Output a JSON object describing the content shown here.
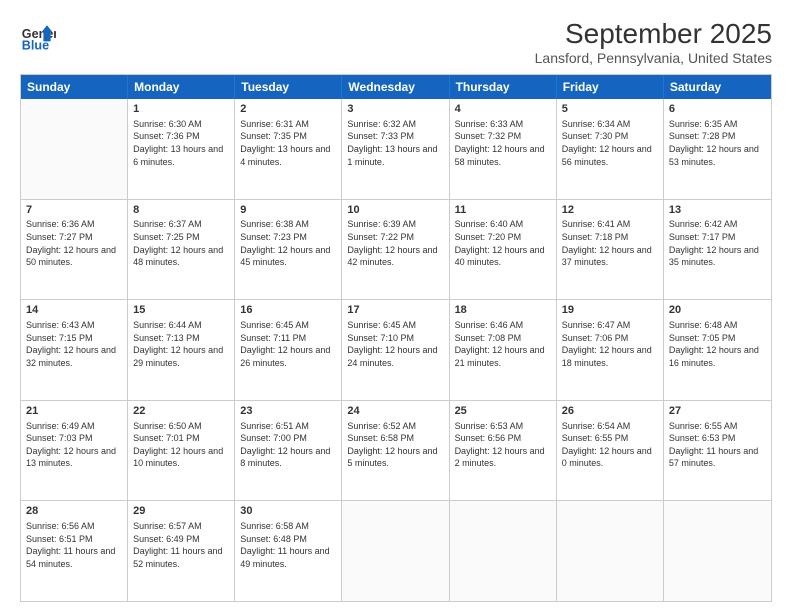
{
  "header": {
    "logo_line1": "General",
    "logo_line2": "Blue",
    "title": "September 2025",
    "subtitle": "Lansford, Pennsylvania, United States"
  },
  "days_of_week": [
    "Sunday",
    "Monday",
    "Tuesday",
    "Wednesday",
    "Thursday",
    "Friday",
    "Saturday"
  ],
  "weeks": [
    [
      {
        "day": "",
        "sunrise": "",
        "sunset": "",
        "daylight": ""
      },
      {
        "day": "1",
        "sunrise": "Sunrise: 6:30 AM",
        "sunset": "Sunset: 7:36 PM",
        "daylight": "Daylight: 13 hours and 6 minutes."
      },
      {
        "day": "2",
        "sunrise": "Sunrise: 6:31 AM",
        "sunset": "Sunset: 7:35 PM",
        "daylight": "Daylight: 13 hours and 4 minutes."
      },
      {
        "day": "3",
        "sunrise": "Sunrise: 6:32 AM",
        "sunset": "Sunset: 7:33 PM",
        "daylight": "Daylight: 13 hours and 1 minute."
      },
      {
        "day": "4",
        "sunrise": "Sunrise: 6:33 AM",
        "sunset": "Sunset: 7:32 PM",
        "daylight": "Daylight: 12 hours and 58 minutes."
      },
      {
        "day": "5",
        "sunrise": "Sunrise: 6:34 AM",
        "sunset": "Sunset: 7:30 PM",
        "daylight": "Daylight: 12 hours and 56 minutes."
      },
      {
        "day": "6",
        "sunrise": "Sunrise: 6:35 AM",
        "sunset": "Sunset: 7:28 PM",
        "daylight": "Daylight: 12 hours and 53 minutes."
      }
    ],
    [
      {
        "day": "7",
        "sunrise": "Sunrise: 6:36 AM",
        "sunset": "Sunset: 7:27 PM",
        "daylight": "Daylight: 12 hours and 50 minutes."
      },
      {
        "day": "8",
        "sunrise": "Sunrise: 6:37 AM",
        "sunset": "Sunset: 7:25 PM",
        "daylight": "Daylight: 12 hours and 48 minutes."
      },
      {
        "day": "9",
        "sunrise": "Sunrise: 6:38 AM",
        "sunset": "Sunset: 7:23 PM",
        "daylight": "Daylight: 12 hours and 45 minutes."
      },
      {
        "day": "10",
        "sunrise": "Sunrise: 6:39 AM",
        "sunset": "Sunset: 7:22 PM",
        "daylight": "Daylight: 12 hours and 42 minutes."
      },
      {
        "day": "11",
        "sunrise": "Sunrise: 6:40 AM",
        "sunset": "Sunset: 7:20 PM",
        "daylight": "Daylight: 12 hours and 40 minutes."
      },
      {
        "day": "12",
        "sunrise": "Sunrise: 6:41 AM",
        "sunset": "Sunset: 7:18 PM",
        "daylight": "Daylight: 12 hours and 37 minutes."
      },
      {
        "day": "13",
        "sunrise": "Sunrise: 6:42 AM",
        "sunset": "Sunset: 7:17 PM",
        "daylight": "Daylight: 12 hours and 35 minutes."
      }
    ],
    [
      {
        "day": "14",
        "sunrise": "Sunrise: 6:43 AM",
        "sunset": "Sunset: 7:15 PM",
        "daylight": "Daylight: 12 hours and 32 minutes."
      },
      {
        "day": "15",
        "sunrise": "Sunrise: 6:44 AM",
        "sunset": "Sunset: 7:13 PM",
        "daylight": "Daylight: 12 hours and 29 minutes."
      },
      {
        "day": "16",
        "sunrise": "Sunrise: 6:45 AM",
        "sunset": "Sunset: 7:11 PM",
        "daylight": "Daylight: 12 hours and 26 minutes."
      },
      {
        "day": "17",
        "sunrise": "Sunrise: 6:45 AM",
        "sunset": "Sunset: 7:10 PM",
        "daylight": "Daylight: 12 hours and 24 minutes."
      },
      {
        "day": "18",
        "sunrise": "Sunrise: 6:46 AM",
        "sunset": "Sunset: 7:08 PM",
        "daylight": "Daylight: 12 hours and 21 minutes."
      },
      {
        "day": "19",
        "sunrise": "Sunrise: 6:47 AM",
        "sunset": "Sunset: 7:06 PM",
        "daylight": "Daylight: 12 hours and 18 minutes."
      },
      {
        "day": "20",
        "sunrise": "Sunrise: 6:48 AM",
        "sunset": "Sunset: 7:05 PM",
        "daylight": "Daylight: 12 hours and 16 minutes."
      }
    ],
    [
      {
        "day": "21",
        "sunrise": "Sunrise: 6:49 AM",
        "sunset": "Sunset: 7:03 PM",
        "daylight": "Daylight: 12 hours and 13 minutes."
      },
      {
        "day": "22",
        "sunrise": "Sunrise: 6:50 AM",
        "sunset": "Sunset: 7:01 PM",
        "daylight": "Daylight: 12 hours and 10 minutes."
      },
      {
        "day": "23",
        "sunrise": "Sunrise: 6:51 AM",
        "sunset": "Sunset: 7:00 PM",
        "daylight": "Daylight: 12 hours and 8 minutes."
      },
      {
        "day": "24",
        "sunrise": "Sunrise: 6:52 AM",
        "sunset": "Sunset: 6:58 PM",
        "daylight": "Daylight: 12 hours and 5 minutes."
      },
      {
        "day": "25",
        "sunrise": "Sunrise: 6:53 AM",
        "sunset": "Sunset: 6:56 PM",
        "daylight": "Daylight: 12 hours and 2 minutes."
      },
      {
        "day": "26",
        "sunrise": "Sunrise: 6:54 AM",
        "sunset": "Sunset: 6:55 PM",
        "daylight": "Daylight: 12 hours and 0 minutes."
      },
      {
        "day": "27",
        "sunrise": "Sunrise: 6:55 AM",
        "sunset": "Sunset: 6:53 PM",
        "daylight": "Daylight: 11 hours and 57 minutes."
      }
    ],
    [
      {
        "day": "28",
        "sunrise": "Sunrise: 6:56 AM",
        "sunset": "Sunset: 6:51 PM",
        "daylight": "Daylight: 11 hours and 54 minutes."
      },
      {
        "day": "29",
        "sunrise": "Sunrise: 6:57 AM",
        "sunset": "Sunset: 6:49 PM",
        "daylight": "Daylight: 11 hours and 52 minutes."
      },
      {
        "day": "30",
        "sunrise": "Sunrise: 6:58 AM",
        "sunset": "Sunset: 6:48 PM",
        "daylight": "Daylight: 11 hours and 49 minutes."
      },
      {
        "day": "",
        "sunrise": "",
        "sunset": "",
        "daylight": ""
      },
      {
        "day": "",
        "sunrise": "",
        "sunset": "",
        "daylight": ""
      },
      {
        "day": "",
        "sunrise": "",
        "sunset": "",
        "daylight": ""
      },
      {
        "day": "",
        "sunrise": "",
        "sunset": "",
        "daylight": ""
      }
    ]
  ]
}
